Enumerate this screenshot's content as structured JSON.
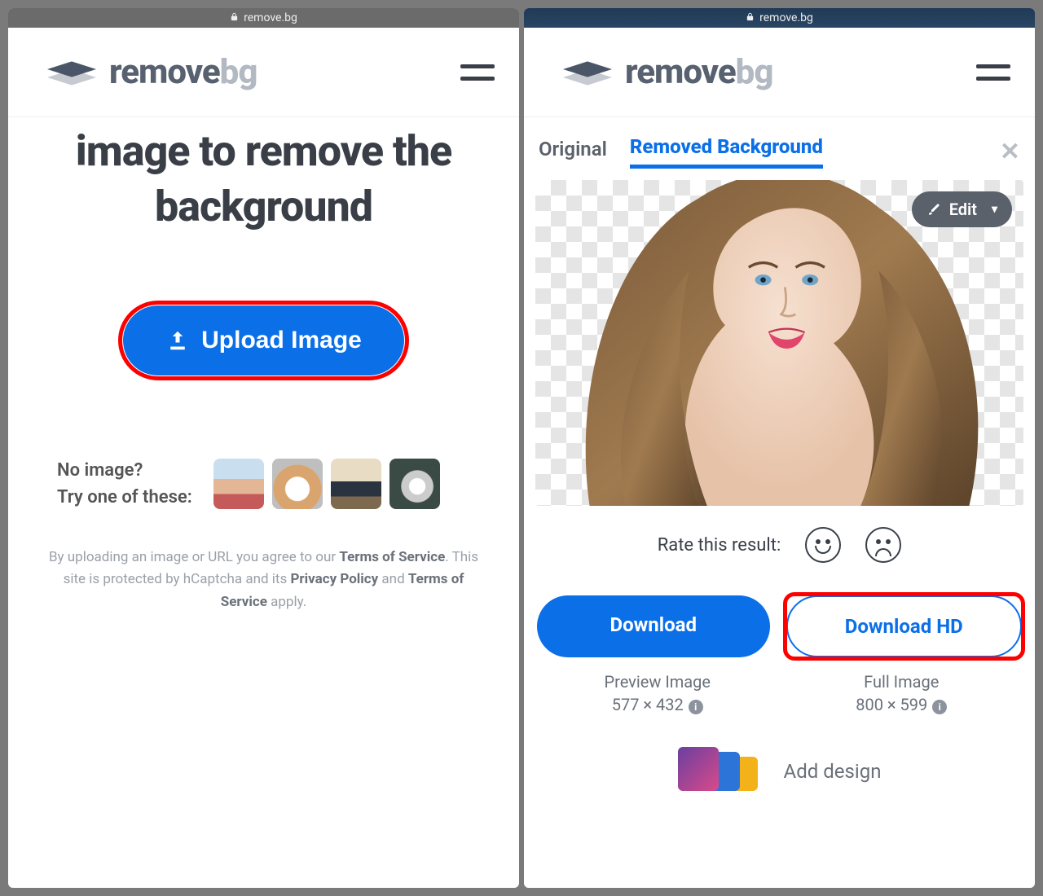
{
  "address_bar": {
    "domain": "remove.bg"
  },
  "brand": {
    "name": "remove",
    "suffix": "bg"
  },
  "left": {
    "headline": "image to remove the background",
    "upload_label": "Upload Image",
    "noimage_line1": "No image?",
    "noimage_line2": "Try one of these:",
    "disclaimer_pre": "By uploading an image or URL you agree to our ",
    "tos": "Terms of Service",
    "disclaimer_mid": ". This site is protected by hCaptcha and its ",
    "pp": "Privacy Policy",
    "disclaimer_and": " and ",
    "tos2": "Terms of Service",
    "disclaimer_apply": " apply."
  },
  "right": {
    "tabs": {
      "original": "Original",
      "removed": "Removed Background"
    },
    "edit": "Edit",
    "rate_label": "Rate this result:",
    "download": "Download",
    "download_hd": "Download HD",
    "preview_label": "Preview Image",
    "preview_dim": "577 × 432",
    "full_label": "Full Image",
    "full_dim": "800 × 599",
    "add_design": "Add design"
  }
}
